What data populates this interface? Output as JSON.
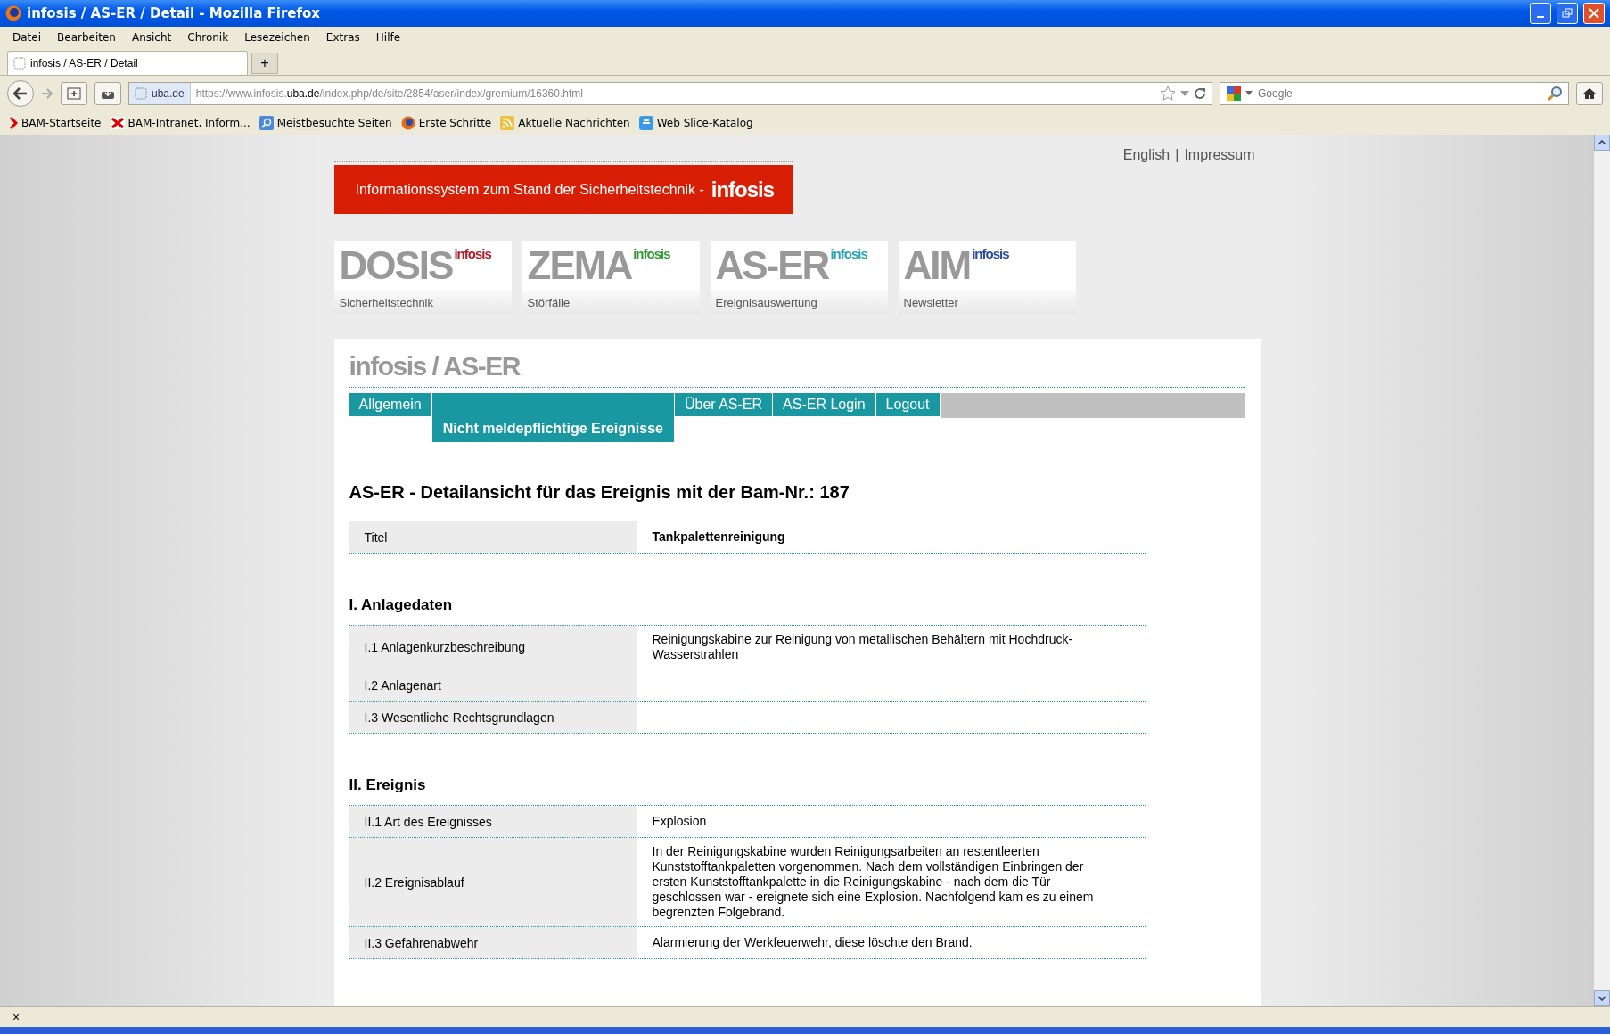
{
  "window": {
    "title": "infosis / AS-ER / Detail - Mozilla Firefox"
  },
  "menu": [
    "Datei",
    "Bearbeiten",
    "Ansicht",
    "Chronik",
    "Lesezeichen",
    "Extras",
    "Hilfe"
  ],
  "browser_tab": {
    "title": "infosis / AS-ER / Detail",
    "new_tab": "+"
  },
  "address_bar": {
    "site": "uba.de",
    "url_prefix": "https://www.infosis.",
    "url_host": "uba.de",
    "url_path": "/index.php/de/site/2854/aser/index/gremium/16360.html"
  },
  "search": {
    "placeholder": "Google"
  },
  "bookmarks": [
    {
      "kind": "chevron",
      "label": "BAM-Startseite"
    },
    {
      "kind": "cross",
      "label": "BAM-Intranet, Inform..."
    },
    {
      "kind": "magnifier",
      "label": "Meistbesuchte Seiten"
    },
    {
      "kind": "globe",
      "label": "Erste Schritte"
    },
    {
      "kind": "feed",
      "label": "Aktuelle Nachrichten"
    },
    {
      "kind": "slice",
      "label": "Web Slice-Katalog"
    }
  ],
  "page": {
    "top_links": [
      "English",
      "Impressum"
    ],
    "separator": "|",
    "banner": {
      "text": "Informationssystem zum Stand der Sicherheitstechnik -",
      "brand": "infosis"
    },
    "portals": [
      {
        "name": "DOSIS",
        "brand": "infosis",
        "color": "#b01c2a",
        "caption": "Sicherheitstechnik"
      },
      {
        "name": "ZEMA",
        "brand": "infosis",
        "color": "#2f9a35",
        "caption": "Störfälle"
      },
      {
        "name": "AS-ER",
        "brand": "infosis",
        "color": "#2aa3b5",
        "caption": "Ereignisauswertung"
      },
      {
        "name": "AIM",
        "brand": "infosis",
        "color": "#2a4c9e",
        "caption": "Newsletter"
      }
    ],
    "section_title": "infosis / AS-ER",
    "nav": [
      {
        "label": "Allgemein",
        "selected": false
      },
      {
        "label": "Nicht meldepflichtige Ereignisse",
        "selected": true
      },
      {
        "label": "Über AS-ER",
        "selected": false
      },
      {
        "label": "AS-ER Login",
        "selected": false
      },
      {
        "label": "Logout",
        "selected": false
      }
    ],
    "heading": "AS-ER - Detailansicht für das Ereignis mit der Bam-Nr.: 187",
    "title_row": {
      "label": "Titel",
      "value": "Tankpalettenreinigung"
    },
    "sections": [
      {
        "title": "I. Anlagedaten",
        "rows": [
          {
            "label": "I.1 Anlagenkurzbeschreibung",
            "value": "Reinigungskabine zur Reinigung von metallischen Behältern mit Hochdruck-Wasserstrahlen"
          },
          {
            "label": "I.2 Anlagenart"
          },
          {
            "label": "I.3 Wesentliche Rechtsgrundlagen"
          }
        ]
      },
      {
        "title": "II. Ereignis",
        "rows": [
          {
            "label": "II.1 Art des Ereignisses",
            "value": "Explosion"
          },
          {
            "label": "II.2 Ereignisablauf",
            "value": "In der Reinigungskabine wurden Reinigungsarbeiten an restentleerten Kunststofftankpaletten vorgenommen. Nach dem vollständigen Einbringen der ersten Kunststofftankpalette in die Reinigungskabine - nach dem die Tür geschlossen war - ereignete sich eine Explosion. Nachfolgend kam es zu einem begrenzten Folgebrand."
          },
          {
            "label": "II.3 Gefahrenabwehr",
            "value": "Alarmierung der Werkfeuerwehr, diese löschte den Brand."
          }
        ]
      }
    ]
  },
  "status_bar": {
    "close": "×"
  }
}
